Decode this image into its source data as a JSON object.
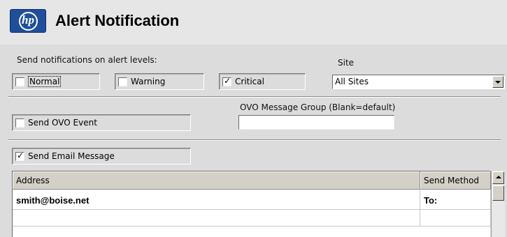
{
  "header": {
    "logo_text": "hp",
    "title": "Alert Notification"
  },
  "levels": {
    "label": "Send notifications on alert levels:",
    "normal": {
      "label": "Normal",
      "checked": false
    },
    "warning": {
      "label": "Warning",
      "checked": false
    },
    "critical": {
      "label": "Critical",
      "checked": true
    }
  },
  "site": {
    "label": "Site",
    "selected": "All Sites"
  },
  "ovo": {
    "send_event_label": "Send OVO Event",
    "send_event_checked": false,
    "group_label": "OVO Message Group (Blank=default)",
    "group_value": ""
  },
  "email": {
    "send_label": "Send Email Message",
    "send_checked": true
  },
  "table": {
    "columns": [
      "Address",
      "Send Method"
    ],
    "rows": [
      {
        "address": "smith@boise.net",
        "method": "To:"
      },
      {
        "address": "",
        "method": ""
      }
    ]
  },
  "colors": {
    "logo_blue": "#1f4f9a",
    "panel_bg": "#dcdcdc"
  }
}
